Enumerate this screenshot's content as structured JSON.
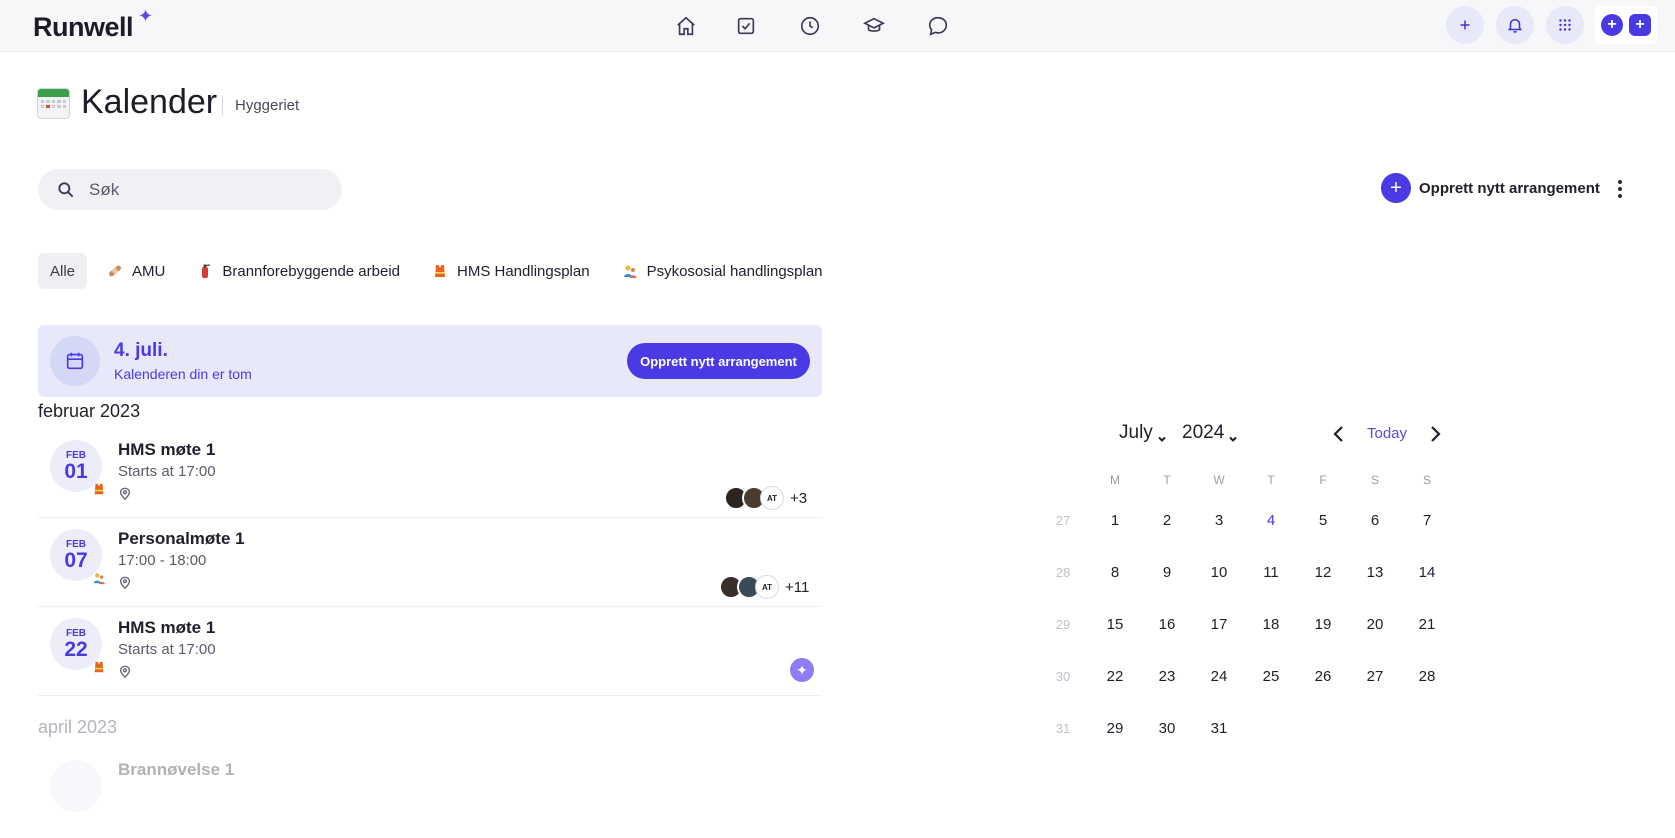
{
  "app": {
    "logo_text": "Runwell",
    "logo_mark": "✦",
    "nav_icons": [
      "home-icon",
      "tasks-icon",
      "clock-icon",
      "courses-icon",
      "chat-icon"
    ],
    "right_actions": [
      "add-icon",
      "bell-icon",
      "apps-grid-icon"
    ]
  },
  "header": {
    "title": "Kalender",
    "organization": "Hyggeriet"
  },
  "search": {
    "placeholder": "Søk"
  },
  "toolbar": {
    "create_label": "Opprett nytt arrangement"
  },
  "filters": [
    {
      "label": "Alle",
      "active": true
    },
    {
      "label": "AMU",
      "icon": "bandage-icon"
    },
    {
      "label": "Brannforebyggende arbeid",
      "icon": "fire-extinguisher-icon"
    },
    {
      "label": "HMS Handlingsplan",
      "icon": "safety-vest-icon"
    },
    {
      "label": "Psykososial handlingsplan",
      "icon": "people-icon"
    }
  ],
  "banner": {
    "date": "4. juli.",
    "message": "Kalenderen din er tom",
    "button": "Opprett nytt arrangement"
  },
  "sections": [
    {
      "month": "februar 2023",
      "events": [
        {
          "month_abbr": "FEB",
          "day": "01",
          "title": "HMS møte 1",
          "time": "Starts at 17:00",
          "more": "+3",
          "initials": "AT"
        },
        {
          "month_abbr": "FEB",
          "day": "07",
          "title": "Personalmøte 1",
          "time": "17:00 - 18:00",
          "more": "+11",
          "initials": "AT"
        },
        {
          "month_abbr": "FEB",
          "day": "22",
          "title": "HMS møte 1",
          "time": "Starts at 17:00"
        }
      ]
    },
    {
      "month": "april 2023",
      "events": [
        {
          "title": "Brannøvelse 1"
        }
      ]
    }
  ],
  "mini_calendar": {
    "month": "July",
    "year": "2024",
    "today_label": "Today",
    "weekdays": [
      "M",
      "T",
      "W",
      "T",
      "F",
      "S",
      "S"
    ],
    "weeks": [
      {
        "week": "27",
        "days": [
          "1",
          "2",
          "3",
          "4",
          "5",
          "6",
          "7"
        ]
      },
      {
        "week": "28",
        "days": [
          "8",
          "9",
          "10",
          "11",
          "12",
          "13",
          "14"
        ]
      },
      {
        "week": "29",
        "days": [
          "15",
          "16",
          "17",
          "18",
          "19",
          "20",
          "21"
        ]
      },
      {
        "week": "30",
        "days": [
          "22",
          "23",
          "24",
          "25",
          "26",
          "27",
          "28"
        ]
      },
      {
        "week": "31",
        "days": [
          "29",
          "30",
          "31"
        ]
      }
    ],
    "today": "4"
  },
  "colors": {
    "accent": "#4a3ae6",
    "banner_bg": "#e7e9fb"
  }
}
